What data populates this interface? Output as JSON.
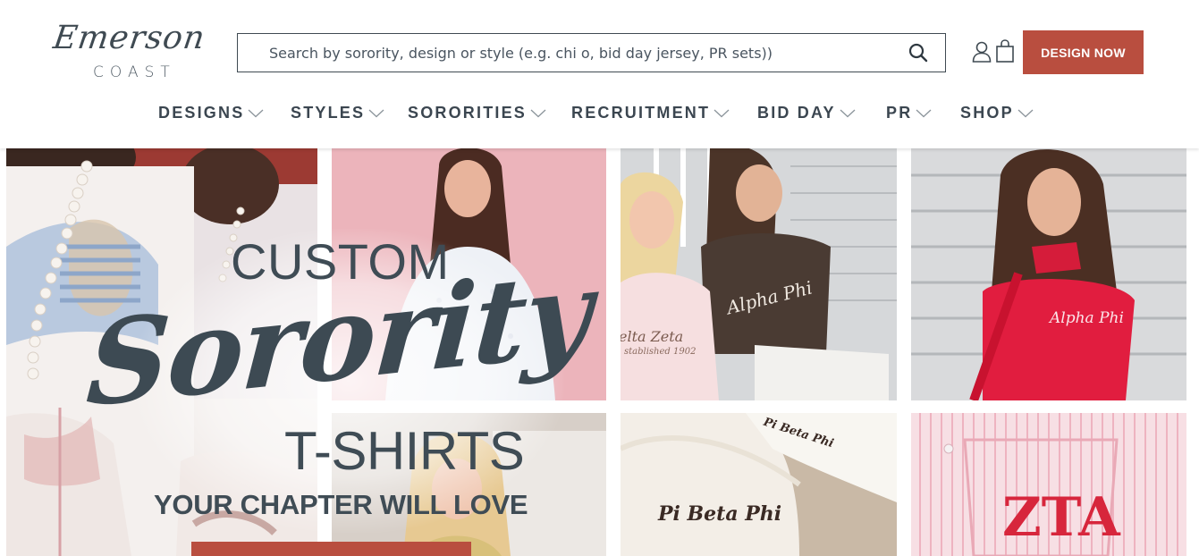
{
  "brand": {
    "logo_script": "Emerson",
    "logo_sub": "COAST"
  },
  "search": {
    "placeholder": "Search by sorority, design or style (e.g. chi o, bid day jersey, PR sets))"
  },
  "header": {
    "account_icon": "user-icon",
    "cart_icon": "shopping-bag-icon",
    "cta_label": "DESIGN NOW",
    "cta_color": "#b94e3f"
  },
  "nav": {
    "items": [
      {
        "label": "DESIGNS"
      },
      {
        "label": "STYLES"
      },
      {
        "label": "SORORITIES"
      },
      {
        "label": "RECRUITMENT"
      },
      {
        "label": "BID DAY"
      },
      {
        "label": "PR"
      },
      {
        "label": "SHOP"
      }
    ]
  },
  "hero": {
    "line1": "CUSTOM",
    "line2": "Sorority",
    "line3": "T-SHIRTS",
    "line4": "YOUR CHAPTER WILL LOVE",
    "text_color": "#3f4c55",
    "images": {
      "tile_top_center": {
        "text": ""
      },
      "tile_brown_shirt": {
        "text": "Alpha Phi"
      },
      "tile_pink_sweatshirt": {
        "text": "elta Zeta"
      },
      "tile_pink_sweatshirt_sub": {
        "text": "stablished 1902"
      },
      "tile_red_top": {
        "text": "Alpha Phi"
      },
      "tile_white_top_a": {
        "text": "Pi Beta Phi"
      },
      "tile_white_top_b": {
        "text": "Pi Beta Phi"
      },
      "tile_striped_shirt": {
        "text": "ZTA"
      }
    }
  }
}
